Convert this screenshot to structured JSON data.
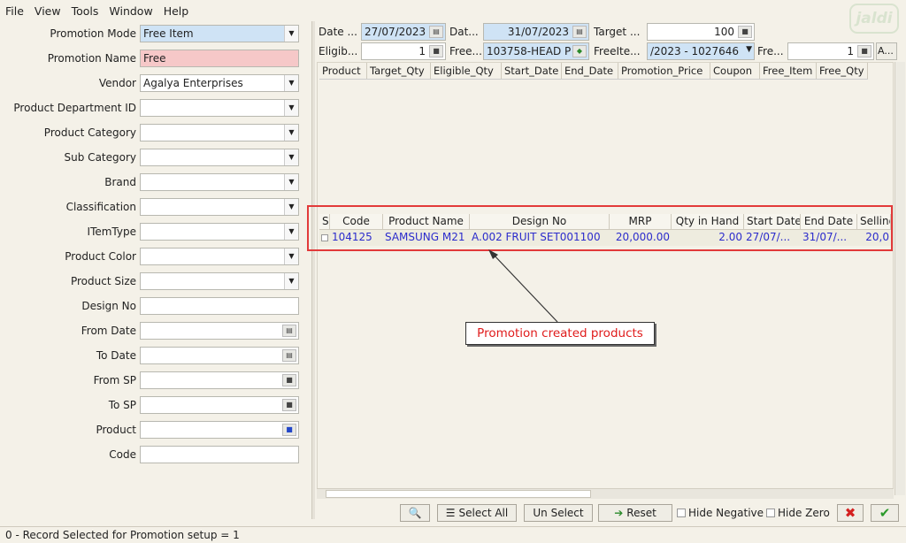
{
  "menu": [
    "File",
    "View",
    "Tools",
    "Window",
    "Help"
  ],
  "logo_text": "jaldi",
  "form": [
    {
      "label": "Promotion Mode",
      "value": "Free Item",
      "kind": "dropdown",
      "style": "blue"
    },
    {
      "label": "Promotion Name",
      "value": "Free",
      "kind": "text",
      "style": "pink"
    },
    {
      "label": "Vendor",
      "value": "Agalya Enterprises",
      "kind": "dropdown",
      "style": ""
    },
    {
      "label": "Product Department ID",
      "value": "",
      "kind": "dropdown",
      "style": ""
    },
    {
      "label": "Product Category",
      "value": "",
      "kind": "dropdown",
      "style": ""
    },
    {
      "label": "Sub Category",
      "value": "",
      "kind": "dropdown",
      "style": ""
    },
    {
      "label": "Brand",
      "value": "",
      "kind": "dropdown",
      "style": ""
    },
    {
      "label": "Classification",
      "value": "",
      "kind": "dropdown",
      "style": ""
    },
    {
      "label": "ITemType",
      "value": "",
      "kind": "dropdown",
      "style": ""
    },
    {
      "label": "Product Color",
      "value": "",
      "kind": "dropdown",
      "style": ""
    },
    {
      "label": "Product Size",
      "value": "",
      "kind": "dropdown",
      "style": ""
    },
    {
      "label": "Design No",
      "value": "",
      "kind": "text",
      "style": ""
    },
    {
      "label": "From Date",
      "value": "",
      "kind": "date",
      "style": ""
    },
    {
      "label": "To Date",
      "value": "",
      "kind": "date",
      "style": ""
    },
    {
      "label": "From SP",
      "value": "",
      "kind": "button",
      "style": ""
    },
    {
      "label": "To SP",
      "value": "",
      "kind": "button",
      "style": ""
    },
    {
      "label": "Product",
      "value": "",
      "kind": "lookup",
      "style": ""
    },
    {
      "label": "Code",
      "value": "",
      "kind": "text",
      "style": ""
    }
  ],
  "top_fields": {
    "date1_label": "Date ...",
    "date1_value": "27/07/2023",
    "date2_label": "Dat...",
    "date2_value": "31/07/2023",
    "target_label": "Target ...",
    "target_value": "100",
    "eligib_label": "Eligib...",
    "eligib_value": "1",
    "free_label": "Free...",
    "free_value": "103758-HEAD P",
    "freeitem_label": "FreeIte...",
    "freeitem_value": "/2023 - 1027646",
    "fre_label": "Fre...",
    "fre_value": "1",
    "a_btn": "A..."
  },
  "grid1_headers": [
    "Product",
    "Target_Qty",
    "Eligible_Qty",
    "Start_Date",
    "End_Date",
    "Promotion_Price",
    "Coupon",
    "Free_Item",
    "Free_Qty"
  ],
  "grid2_headers": [
    "S",
    "Code",
    "Product Name",
    "Design No",
    "MRP",
    "Qty in Hand",
    "Start Date",
    "End Date",
    "Selling"
  ],
  "grid2_rows": [
    [
      "",
      "104125",
      "SAMSUNG M21",
      "A.002 FRUIT SET001100",
      "20,000.00",
      "2.00",
      "27/07/...",
      "31/07/...",
      "20,0"
    ]
  ],
  "annotation": "Promotion created products",
  "buttons": {
    "select_all": "Select All",
    "unselect": "Un Select",
    "reset": "Reset"
  },
  "checks": {
    "hide_negative": "Hide Negative",
    "hide_zero": "Hide Zero"
  },
  "status": "0 - Record Selected for Promotion setup = 1",
  "colors": {
    "annotation_red": "#e01b1b",
    "row_text": "#2c2ccc",
    "highlight_blue": "#cfe3f5",
    "highlight_pink": "#f6c8c8"
  }
}
